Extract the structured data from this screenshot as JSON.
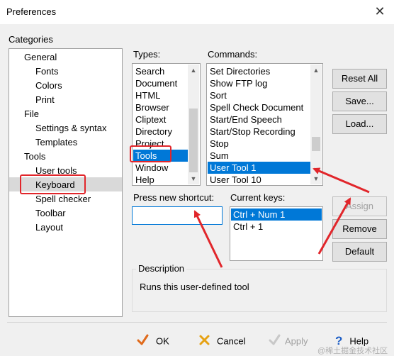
{
  "window": {
    "title": "Preferences"
  },
  "categories": {
    "heading": "Categories",
    "items": [
      {
        "label": "General",
        "level": 0
      },
      {
        "label": "Fonts",
        "level": 1
      },
      {
        "label": "Colors",
        "level": 1
      },
      {
        "label": "Print",
        "level": 1
      },
      {
        "label": "File",
        "level": 0
      },
      {
        "label": "Settings & syntax",
        "level": 1
      },
      {
        "label": "Templates",
        "level": 1
      },
      {
        "label": "Tools",
        "level": 0
      },
      {
        "label": "User tools",
        "level": 1
      },
      {
        "label": "Keyboard",
        "level": 1,
        "selected": true
      },
      {
        "label": "Spell checker",
        "level": 1
      },
      {
        "label": "Toolbar",
        "level": 1
      },
      {
        "label": "Layout",
        "level": 1
      }
    ]
  },
  "types": {
    "label": "Types:",
    "items": [
      "Search",
      "Document",
      "HTML",
      "Browser",
      "Cliptext",
      "Directory",
      "Project",
      "Tools",
      "Window",
      "Help"
    ],
    "selected": "Tools"
  },
  "commands": {
    "label": "Commands:",
    "items": [
      "Set Directories",
      "Show FTP log",
      "Sort",
      "Spell Check Document",
      "Start/End Speech",
      "Start/Stop Recording",
      "Stop",
      "Sum",
      "User Tool 1",
      "User Tool 10"
    ],
    "selected": "User Tool 1"
  },
  "shortcut": {
    "label": "Press new shortcut:",
    "value": ""
  },
  "current_keys": {
    "label": "Current keys:",
    "items": [
      "Ctrl + Num 1",
      "Ctrl + 1"
    ],
    "selected": "Ctrl + Num 1"
  },
  "right_buttons": {
    "reset_all": "Reset All",
    "save": "Save...",
    "load": "Load...",
    "assign": "Assign",
    "remove": "Remove",
    "default": "Default"
  },
  "description": {
    "heading": "Description",
    "text": "Runs this user-defined tool"
  },
  "footer": {
    "ok": "OK",
    "cancel": "Cancel",
    "apply": "Apply",
    "help": "Help",
    "watermark": "@稀土掘金技术社区"
  },
  "colors": {
    "selection": "#0078d7",
    "annotation_red": "#e1262b"
  },
  "icons": {
    "ok": "checkmark-icon",
    "cancel": "x-icon",
    "apply": "checkmark-icon",
    "help": "question-icon"
  }
}
